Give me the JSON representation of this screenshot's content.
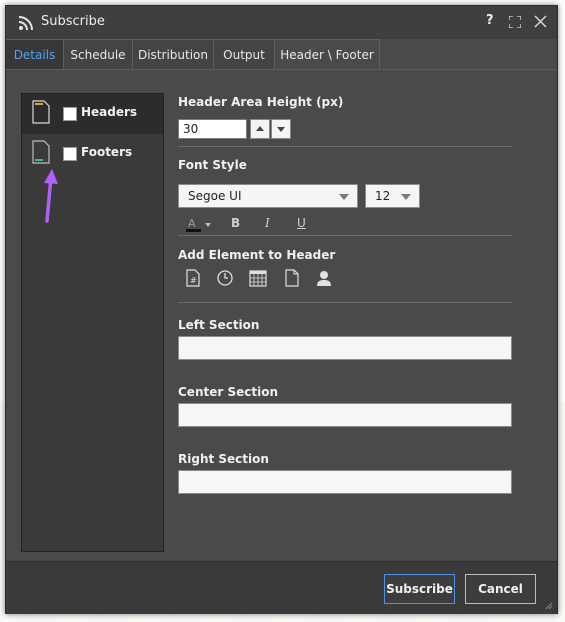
{
  "window": {
    "title": "Subscribe",
    "help": "?"
  },
  "tabs": [
    {
      "label": "Details"
    },
    {
      "label": "Schedule"
    },
    {
      "label": "Distribution"
    },
    {
      "label": "Output"
    },
    {
      "label": "Header \\ Footer"
    }
  ],
  "sidebar": {
    "items": [
      {
        "label": "Headers",
        "checked": false,
        "selected": true
      },
      {
        "label": "Footers",
        "checked": false,
        "selected": false
      }
    ]
  },
  "header_settings": {
    "area_height_label": "Header Area Height (px)",
    "area_height_value": "30",
    "font_style_label": "Font Style",
    "font_family": "Segoe UI",
    "font_size": "12",
    "bold_label": "B",
    "italic_label": "I",
    "underline_label": "U",
    "add_element_label": "Add Element to Header",
    "left_section_label": "Left Section",
    "left_section_value": "",
    "center_section_label": "Center Section",
    "center_section_value": "",
    "right_section_label": "Right Section",
    "right_section_value": ""
  },
  "icons": {
    "font_color": "text-color-icon",
    "page_number": "page-number-icon",
    "time": "clock-icon",
    "date": "calendar-icon",
    "page": "page-icon",
    "user": "user-icon"
  },
  "buttons": {
    "subscribe": "Subscribe",
    "cancel": "Cancel"
  },
  "colors": {
    "accent": "#4ea3ff",
    "annotation_arrow": "#b060ff",
    "header_icon_band": "#e8a040",
    "footer_icon_band": "#4caf9a"
  }
}
